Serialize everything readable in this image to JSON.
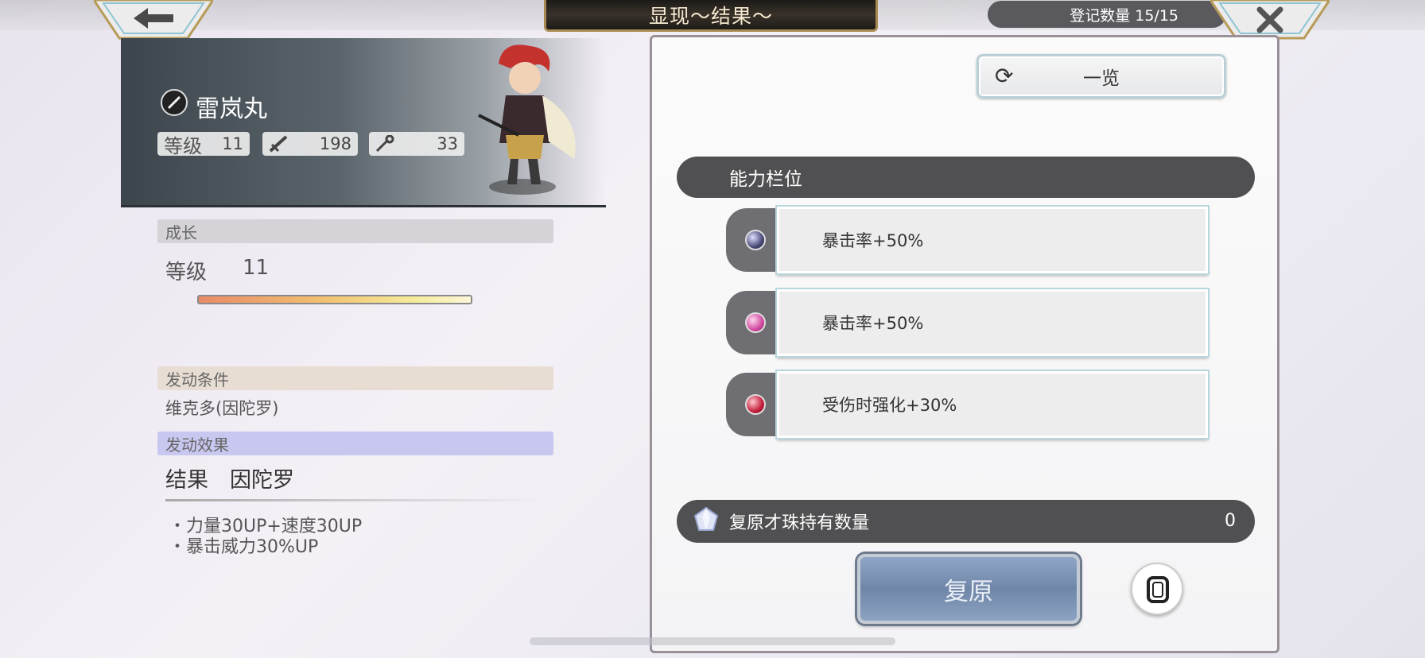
{
  "header": {
    "title": "显现～结果～",
    "register_label": "登记数量 15/15"
  },
  "character": {
    "name": "雷岚丸",
    "level_label": "等级",
    "level": "11",
    "attack": "198",
    "magic": "33"
  },
  "growth": {
    "section_label": "成长",
    "level_label": "等级",
    "level_value": "11",
    "progress": 1.0
  },
  "condition": {
    "section_label": "发动条件",
    "text": "维克多(因陀罗)"
  },
  "effect": {
    "section_label": "发动效果",
    "title": "结果　因陀罗",
    "details": [
      "・力量30UP+速度30UP",
      "・暴击威力30%UP"
    ]
  },
  "list_button": {
    "label": "一览"
  },
  "ability": {
    "section_label": "能力栏位",
    "slots": [
      {
        "text": "暴击率+50%",
        "orb_color": "#4a4a78"
      },
      {
        "text": "暴击率+50%",
        "orb_color": "#d24aa0"
      },
      {
        "text": "受伤时强化+30%",
        "orb_color": "#c41e3c"
      }
    ]
  },
  "restore": {
    "label": "复原才珠持有数量",
    "count": "0",
    "button_label": "复原"
  },
  "icons": {
    "back": "arrow-left-icon",
    "close": "close-icon",
    "refresh": "refresh-icon",
    "gem": "crystal-gem-icon",
    "weapon": "katana-icon",
    "attack": "sword-icon",
    "magic": "staff-icon",
    "round": "rounded-square-icon"
  }
}
